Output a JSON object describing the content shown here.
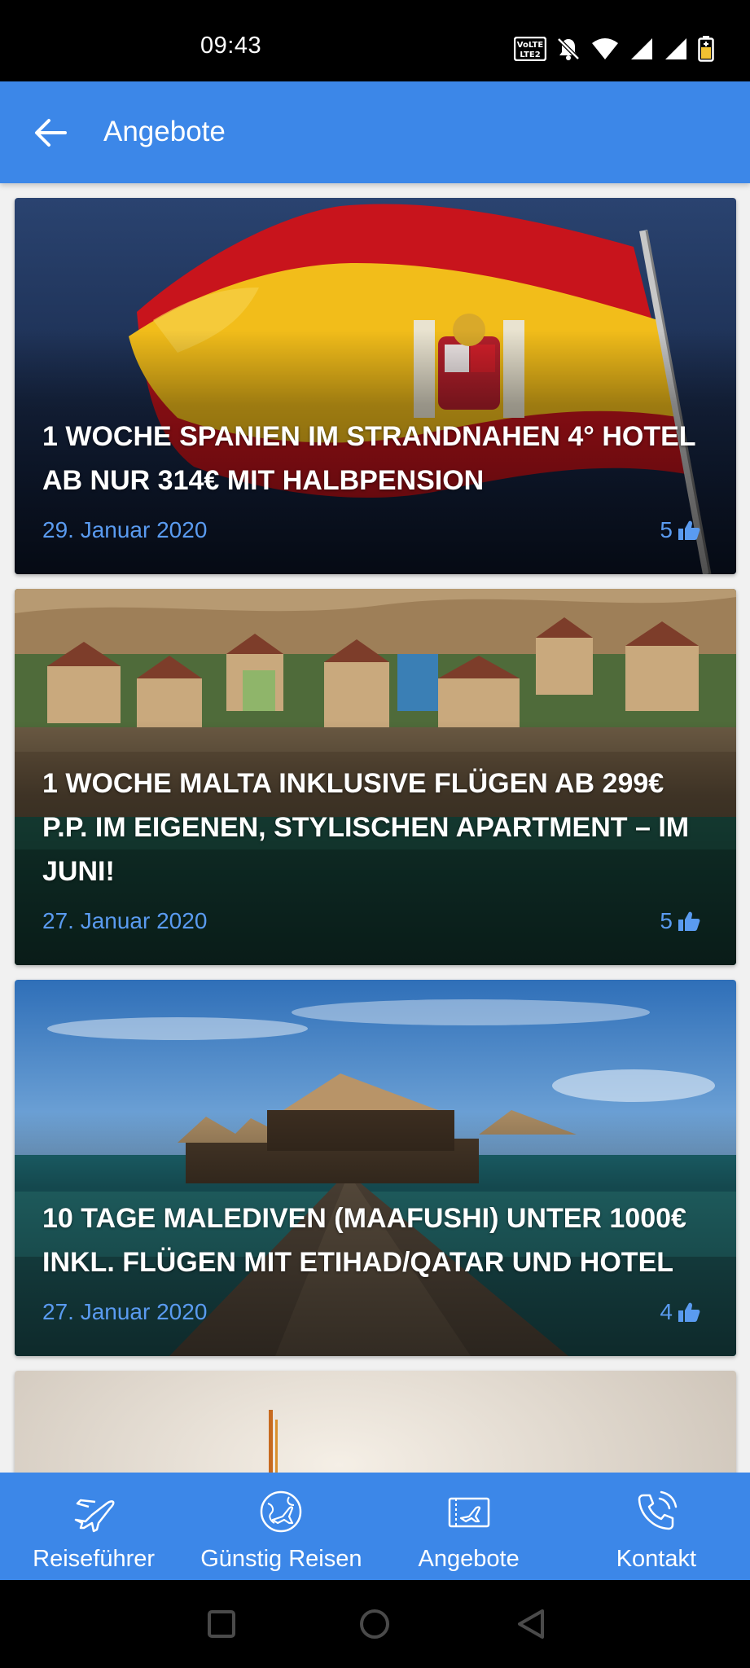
{
  "status_bar": {
    "time": "09:43",
    "icons": [
      "volte-icon",
      "bell-muted-icon",
      "wifi-icon",
      "signal-icon",
      "signal-icon",
      "battery-icon"
    ]
  },
  "app_bar": {
    "title": "Angebote",
    "back_icon": "arrow-left-icon"
  },
  "cards": [
    {
      "title": "1 Woche Spanien im strandnahen 4° Hotel ab nur 314€ mit Halbpension",
      "date": "29. Januar 2020",
      "likes": "5",
      "like_icon": "thumbs-up-icon"
    },
    {
      "title": "1 Woche Malta inklusive Flügen ab 299€ p.P. im eigenen, stylischen Apartment – im Juni!",
      "date": "27. Januar 2020",
      "likes": "5",
      "like_icon": "thumbs-up-icon"
    },
    {
      "title": "10 Tage Malediven (Maafushi) unter 1000€ inkl. Flügen mit Etihad/Qatar und Hotel",
      "date": "27. Januar 2020",
      "likes": "4",
      "like_icon": "thumbs-up-icon"
    }
  ],
  "bottom_nav": [
    {
      "label": "Reiseführer",
      "icon": "airplane-icon"
    },
    {
      "label": "Günstig Reisen",
      "icon": "globe-plane-icon"
    },
    {
      "label": "Angebote",
      "icon": "ticket-plane-icon"
    },
    {
      "label": "Kontakt",
      "icon": "phone-icon"
    }
  ],
  "colors": {
    "primary": "#3c87e8",
    "accent_text": "#5a9bf0",
    "status_bar": "#000000"
  }
}
